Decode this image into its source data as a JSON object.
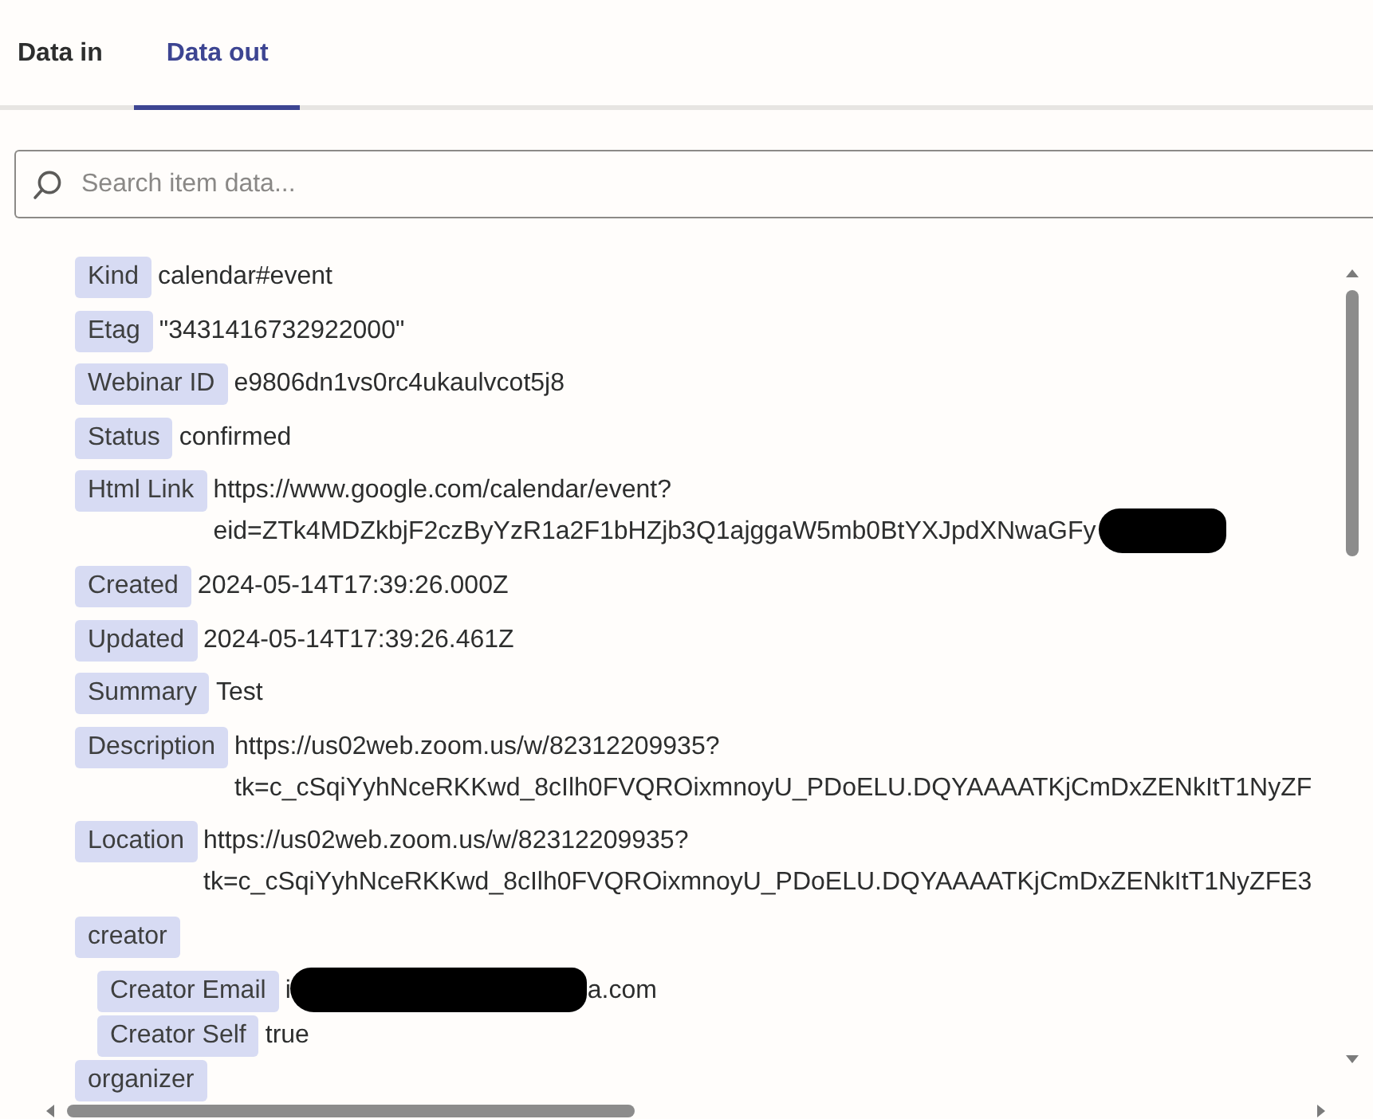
{
  "tabs": [
    {
      "label": "Data in",
      "selected": false
    },
    {
      "label": "Data out",
      "selected": true
    }
  ],
  "search": {
    "placeholder": "Search item data..."
  },
  "fields": [
    {
      "kind": "value",
      "label": "Kind",
      "value_lines": [
        "calendar#event"
      ]
    },
    {
      "kind": "value",
      "label": "Etag",
      "value_lines": [
        "\"3431416732922000\""
      ]
    },
    {
      "kind": "value",
      "label": "Webinar ID",
      "value_lines": [
        "e9806dn1vs0rc4ukaulvcot5j8"
      ]
    },
    {
      "kind": "value",
      "label": "Status",
      "value_lines": [
        "confirmed"
      ]
    },
    {
      "kind": "value",
      "label": "Html Link",
      "value_lines": [
        "https://www.google.com/calendar/event?",
        "eid=ZTk4MDZkbjF2czByYzR1a2F1bHZjb3Q1ajggaW5mb0BtYXJpdXNwaGFy"
      ],
      "redacted": true
    },
    {
      "kind": "value",
      "label": "Created",
      "value_lines": [
        "2024-05-14T17:39:26.000Z"
      ]
    },
    {
      "kind": "value",
      "label": "Updated",
      "value_lines": [
        "2024-05-14T17:39:26.461Z"
      ]
    },
    {
      "kind": "value",
      "label": "Summary",
      "value_lines": [
        "Test"
      ]
    },
    {
      "kind": "value",
      "label": "Description",
      "value_lines": [
        "https://us02web.zoom.us/w/82312209935?",
        "tk=c_cSqiYyhNceRKKwd_8cIlh0FVQROixmnoyU_PDoELU.DQYAAAATKjCmDxZENkItT1NyZF"
      ]
    },
    {
      "kind": "value",
      "label": "Location",
      "value_lines": [
        "https://us02web.zoom.us/w/82312209935?",
        "tk=c_cSqiYyhNceRKKwd_8cIlh0FVQROixmnoyU_PDoELU.DQYAAAATKjCmDxZENkItT1NyZFE3"
      ]
    },
    {
      "kind": "group",
      "label": "creator",
      "children": [
        {
          "kind": "value",
          "label": "Creator Email",
          "value_lines": [
            "i"
          ],
          "redacted": true,
          "value_after": "a.com"
        },
        {
          "kind": "value",
          "label": "Creator Self",
          "value_lines": [
            "true"
          ]
        }
      ]
    },
    {
      "kind": "group",
      "label": "organizer"
    }
  ]
}
